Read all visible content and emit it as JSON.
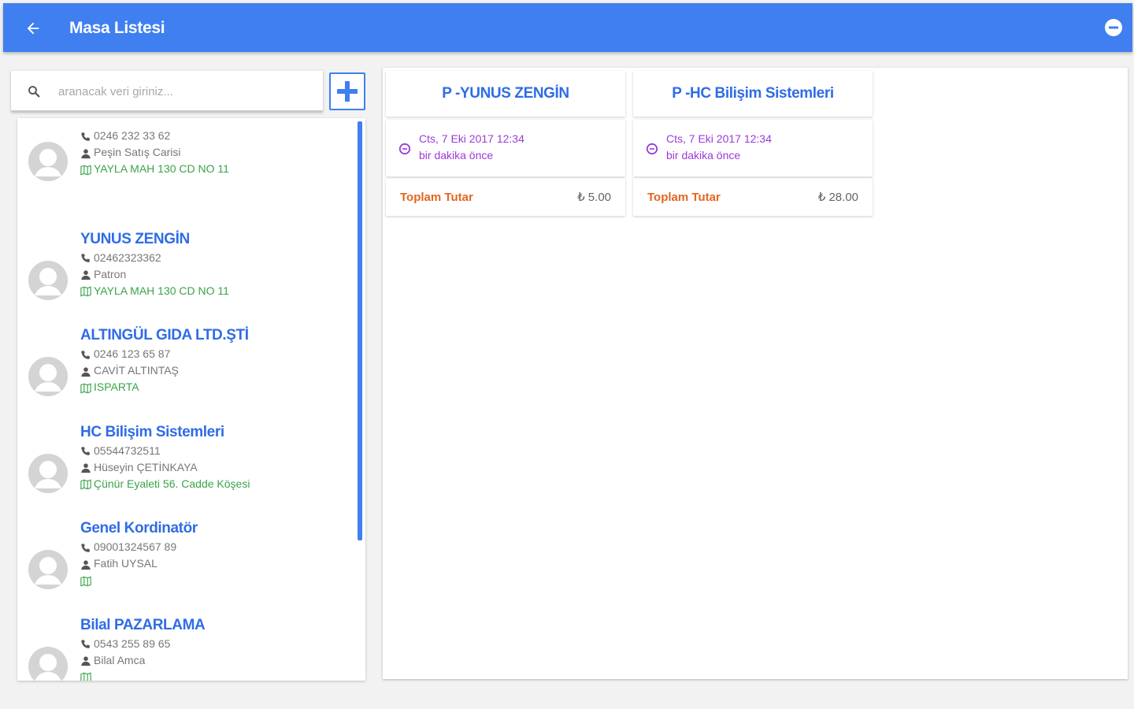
{
  "appbar": {
    "title": "Masa Listesi",
    "accent": "#3f7ff0",
    "back_icon": "arrow-left-icon",
    "menu_icon": "minus-circle-icon"
  },
  "search": {
    "placeholder": "aranacak veri giriniz...",
    "value": "",
    "icon": "search-icon"
  },
  "add_button": {
    "icon": "plus-icon"
  },
  "customers": [
    {
      "name": "",
      "phone": "0246 232 33 62",
      "person": "Peşin Satış Carisi",
      "address": "YAYLA MAH 130 CD NO 11"
    },
    {
      "name": "YUNUS ZENGİN",
      "phone": "02462323362",
      "person": "Patron",
      "address": "YAYLA MAH 130 CD NO 11"
    },
    {
      "name": "ALTINGÜL GIDA LTD.ŞTİ",
      "phone": "0246 123 65 87",
      "person": "CAVİT ALTINTAŞ",
      "address": "ISPARTA"
    },
    {
      "name": "HC Bilişim Sistemleri",
      "phone": "05544732511",
      "person": "Hüseyin ÇETİNKAYA",
      "address": "Çünür Eyaleti 56. Cadde Köşesi"
    },
    {
      "name": "Genel Kordinatör",
      "phone": "09001324567 89",
      "person": "Fatih UYSAL",
      "address": ""
    },
    {
      "name": "Bilal PAZARLAMA",
      "phone": "0543 255 89 65",
      "person": "Bilal Amca",
      "address": ""
    }
  ],
  "tables": [
    {
      "title": "P -YUNUS ZENGİN",
      "date": "Cts, 7 Eki 2017 12:34",
      "relative": "bir dakika önce",
      "total_label": "Toplam Tutar",
      "total_value": "₺ 5.00"
    },
    {
      "title": "P -HC Bilişim Sistemleri",
      "date": "Cts, 7 Eki 2017 12:34",
      "relative": "bir dakika önce",
      "total_label": "Toplam Tutar",
      "total_value": "₺ 28.00"
    }
  ]
}
